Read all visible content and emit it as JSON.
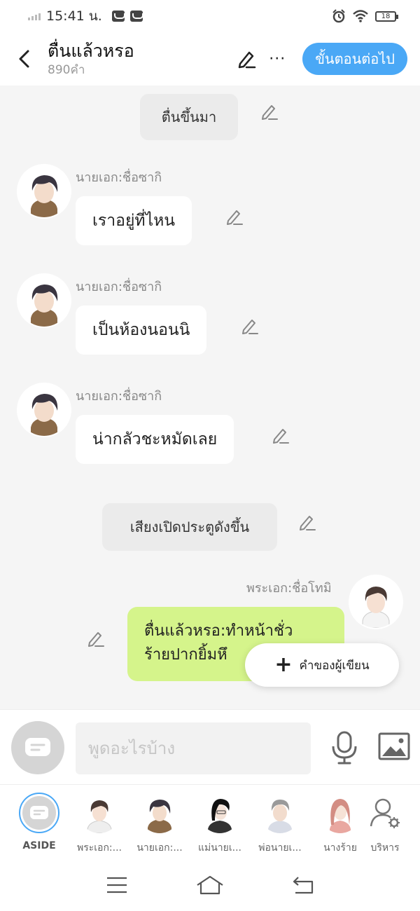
{
  "status_bar": {
    "time": "15:41 น.",
    "battery": "18"
  },
  "header": {
    "title": "ตื่นแล้วหรอ",
    "word_count": "890คำ",
    "next_label": "ขั้นตอนต่อไป",
    "more_label": "···"
  },
  "chat": {
    "narration_1": "ตื่นขึ้นมา",
    "messages": [
      {
        "speaker": "นายเอก:ชื่อซากิ",
        "text": "เราอยู่ที่ไหน"
      },
      {
        "speaker": "นายเอก:ชื่อซากิ",
        "text": "เป็นห้องนอนนิ"
      },
      {
        "speaker": "นายเอก:ชื่อซากิ",
        "text": "น่ากลัวชะหมัดเลย"
      }
    ],
    "narration_2": "เสียงเปิดประตูดังขึ้น",
    "right_message": {
      "speaker": "พระเอก:ชื่อโทมิ",
      "line1": "ตื่นแล้วหรอ:ทำหน้าชั่ว",
      "line2": "ร้ายปากยิ้มหึ"
    },
    "writer_button": "คำของผู้เขียน"
  },
  "input": {
    "placeholder": "พูดอะไรบ้าง"
  },
  "characters": [
    {
      "name": "ASIDE"
    },
    {
      "name": "พระเอก:..."
    },
    {
      "name": "นายเอก:..."
    },
    {
      "name": "แม่นายเ..."
    },
    {
      "name": "พ่อนายเ..."
    },
    {
      "name": "นางร้าย"
    },
    {
      "name": "บริหาร"
    }
  ],
  "colors": {
    "accent": "#4aa8f6",
    "right_bubble": "#d5f48b",
    "chat_bg": "#f5f5f5"
  }
}
